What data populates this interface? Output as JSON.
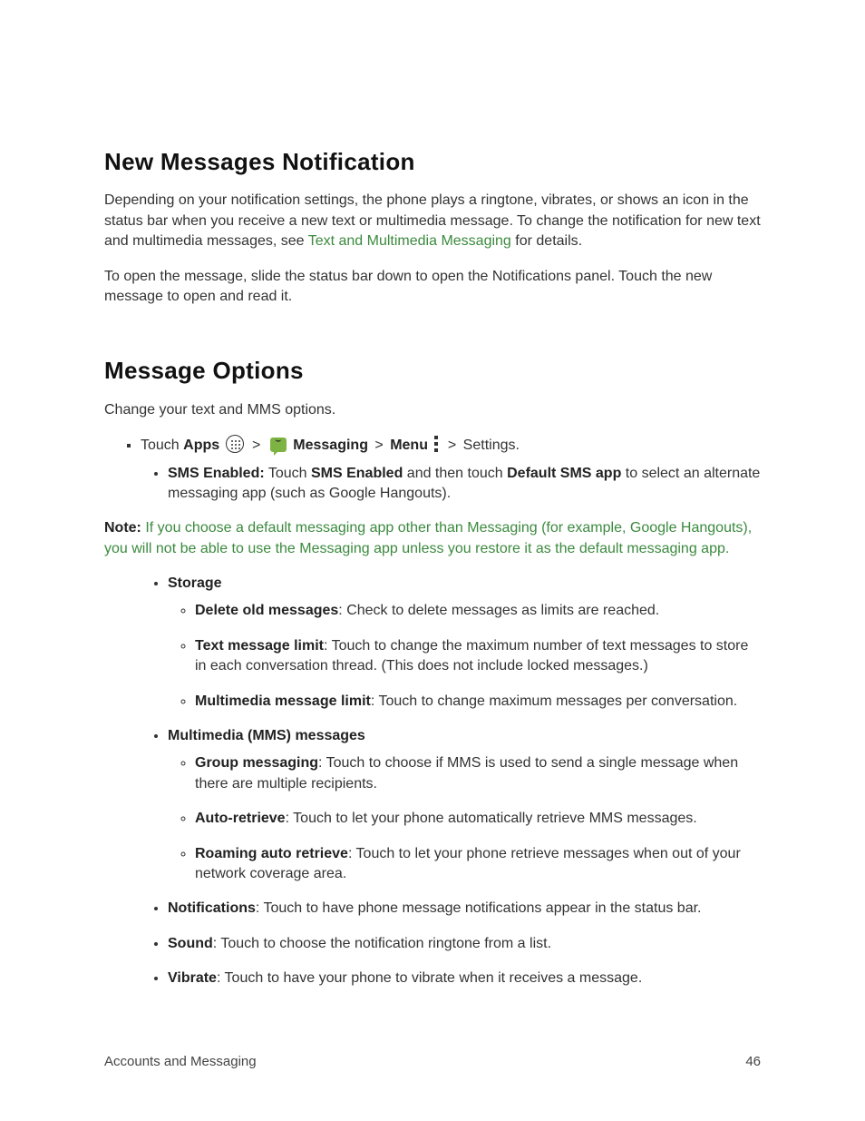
{
  "section1": {
    "heading": "New Messages Notification",
    "para1_pre": "Depending on your notification settings, the phone plays a ringtone, vibrates, or shows an icon in the status bar when you receive a new text or multimedia message. To change the notification for new text and multimedia messages, see ",
    "para1_link": "Text and Multimedia Messaging",
    "para1_post": " for details.",
    "para2": "To open the message, slide the status bar down to open the Notifications panel. Touch the new message to open and read it."
  },
  "section2": {
    "heading": "Message Options",
    "intro": "Change your text and MMS options.",
    "path": {
      "touch": "Touch ",
      "apps": "Apps",
      "sep": " > ",
      "messaging": "Messaging",
      "menu": "Menu",
      "settings": " Settings."
    },
    "sms_enabled": {
      "label": "SMS Enabled:",
      "touch": " Touch ",
      "sms_enabled_bold": "SMS Enabled",
      "and_then": " and then touch ",
      "default_sms_app": "Default SMS app",
      "tail": " to select an alternate messaging app (such as Google Hangouts)."
    },
    "note": {
      "label": "Note:",
      "text": " If you choose a default messaging app other than Messaging (for example, Google Hangouts), you will not be able to use the Messaging app unless you restore it as the default messaging app."
    },
    "storage": {
      "heading": "Storage",
      "items": {
        "delete_old": {
          "label": "Delete old messages",
          "text": ": Check to delete messages as limits are reached."
        },
        "text_limit": {
          "label": "Text message limit",
          "text": ": Touch to change the maximum number of text messages to store in each conversation thread. (This does not include locked messages.)"
        },
        "mms_limit": {
          "label": "Multimedia message limit",
          "text": ": Touch to change maximum messages per conversation."
        }
      }
    },
    "mms": {
      "heading": "Multimedia (MMS) messages",
      "items": {
        "group": {
          "label": "Group messaging",
          "text": ": Touch to choose if MMS is used to send a single message when there are multiple recipients."
        },
        "auto": {
          "label": "Auto-retrieve",
          "text": ": Touch to let your phone automatically retrieve MMS messages."
        },
        "roaming": {
          "label": "Roaming auto retrieve",
          "text": ": Touch to let your phone retrieve messages when out of your network coverage area."
        }
      }
    },
    "notifications": {
      "label": "Notifications",
      "text": ": Touch to have phone message notifications appear in the status bar."
    },
    "sound": {
      "label": "Sound",
      "text": ": Touch to choose the notification ringtone from a list."
    },
    "vibrate": {
      "label": "Vibrate",
      "text": ": Touch to have your phone to vibrate when it receives a message."
    }
  },
  "footer": {
    "left": "Accounts and Messaging",
    "right": "46"
  }
}
